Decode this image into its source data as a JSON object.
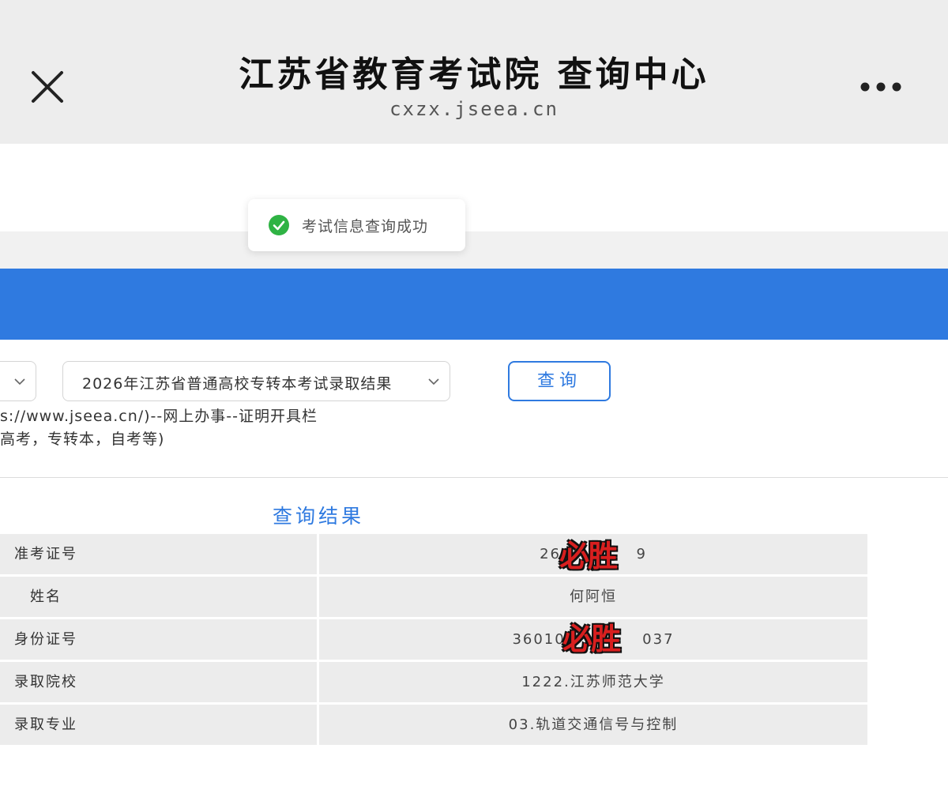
{
  "header": {
    "title": "江苏省教育考试院 查询中心",
    "subtitle": "cxzx.jseea.cn"
  },
  "toast": {
    "text": "考试信息查询成功"
  },
  "query": {
    "exam_select_value": "2026年江苏省普通高校专转本考试录取结果",
    "button_label": "查询"
  },
  "notes": {
    "line1": "s://www.jseea.cn/)--网上办事--证明开具栏",
    "line2": "高考，专转本，自考等)"
  },
  "result": {
    "title": "查询结果",
    "rows": [
      {
        "label": "准考证号",
        "value": "261"
      },
      {
        "label": "姓名",
        "value": "何阿恒"
      },
      {
        "label": "身份证号",
        "value": "360102"
      },
      {
        "label": "录取院校",
        "value": "1222.江苏师范大学"
      },
      {
        "label": "录取专业",
        "value": "03.轨道交通信号与控制"
      }
    ],
    "row1_value_suffix": "9",
    "row3_value_suffix": "037"
  },
  "stickers": {
    "text": "必胜"
  },
  "colors": {
    "header_bg": "#ededed",
    "banner_blue": "#2f7ae0",
    "success_green": "#2fb344",
    "table_bg": "#ececec"
  }
}
